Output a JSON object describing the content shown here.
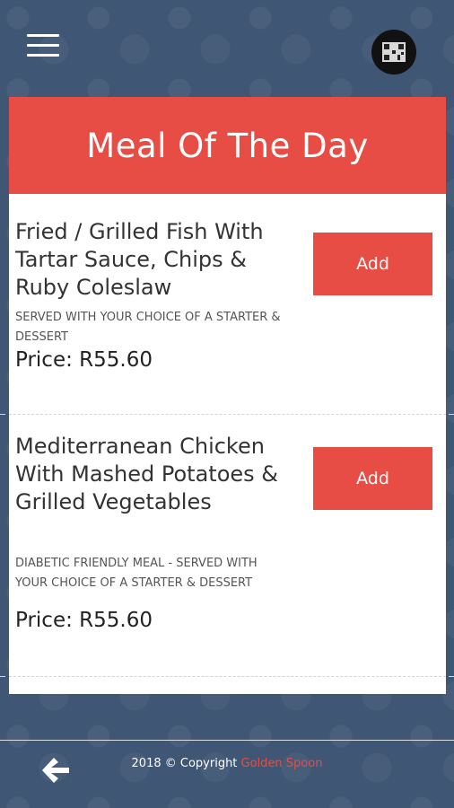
{
  "header": {
    "menu_icon": "hamburger-menu-icon",
    "qr_icon": "qr-code-icon"
  },
  "card": {
    "title": "Meal Of The Day"
  },
  "items": [
    {
      "title": "Fried / Grilled Fish With Tartar Sauce, Chips & Ruby Coleslaw",
      "description": "SERVED WITH YOUR CHOICE OF A STARTER & DESSERT",
      "price": "Price: R55.60",
      "button_label": "Add"
    },
    {
      "title": "Mediterranean Chicken With Mashed Potatoes & Grilled Vegetables",
      "description": "DIABETIC FRIENDLY MEAL - SERVED WITH YOUR CHOICE OF A STARTER & DESSERT",
      "price": "Price: R55.60",
      "button_label": "Add"
    }
  ],
  "footer": {
    "back_icon": "arrow-left-icon",
    "copyright_prefix": "2018 © Copyright",
    "brand": "Golden Spoon"
  },
  "colors": {
    "background": "#3f5675",
    "accent": "#e84d45"
  }
}
